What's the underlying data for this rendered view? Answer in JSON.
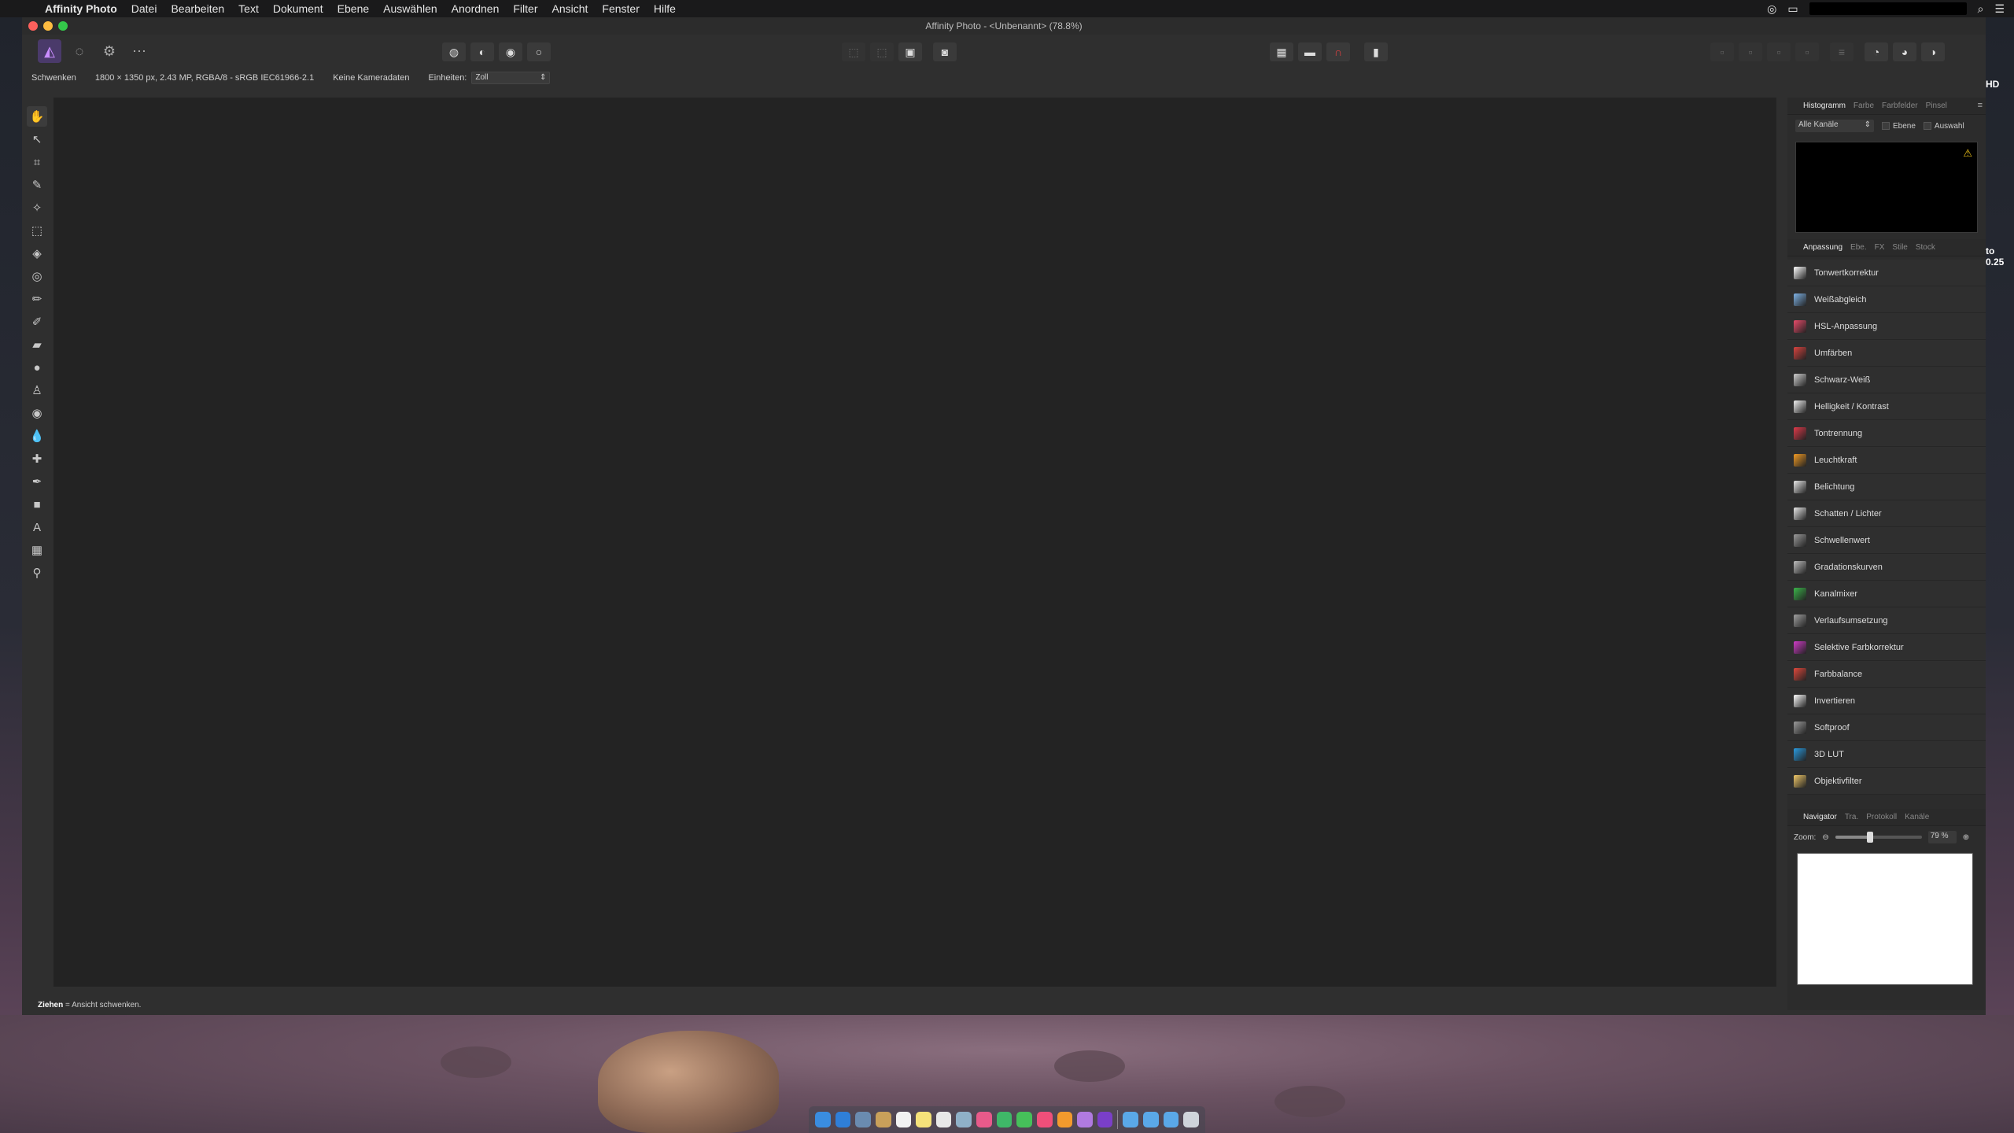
{
  "menubar": {
    "app_name": "Affinity Photo",
    "items": [
      "Datei",
      "Bearbeiten",
      "Text",
      "Dokument",
      "Ebene",
      "Auswählen",
      "Anordnen",
      "Filter",
      "Ansicht",
      "Fenster",
      "Hilfe"
    ]
  },
  "window": {
    "title": "Affinity Photo - <Unbenannt> (78.8%)"
  },
  "context_toolbar": {
    "tool_name": "Schwenken",
    "doc_info": "1800 × 1350 px, 2.43 MP, RGBA/8 - sRGB IEC61966-2.1",
    "camera": "Keine Kameradaten",
    "units_label": "Einheiten:",
    "units_value": "Zoll"
  },
  "status": {
    "key": "Ziehen",
    "text": " = Ansicht schwenken."
  },
  "histogram_panel": {
    "tabs": [
      "Histogramm",
      "Farbe",
      "Farbfelder",
      "Pinsel"
    ],
    "channel_select": "Alle Kanäle",
    "layer_label": "Ebene",
    "selection_label": "Auswahl"
  },
  "adjust_panel": {
    "tabs": [
      "Anpassung",
      "Ebe.",
      "FX",
      "Stile",
      "Stock"
    ],
    "items": [
      {
        "label": "Tonwertkorrektur",
        "color": "#ffffff"
      },
      {
        "label": "Weißabgleich",
        "color": "#7fb3e6"
      },
      {
        "label": "HSL-Anpassung",
        "color": "#e94b6a"
      },
      {
        "label": "Umfärben",
        "color": "#d9433f"
      },
      {
        "label": "Schwarz-Weiß",
        "color": "#cfcfcf"
      },
      {
        "label": "Helligkeit / Kontrast",
        "color": "#f0f0f0"
      },
      {
        "label": "Tontrennung",
        "color": "#e03a4a"
      },
      {
        "label": "Leuchtkraft",
        "color": "#f29b24"
      },
      {
        "label": "Belichtung",
        "color": "#e8e8e8"
      },
      {
        "label": "Schatten / Lichter",
        "color": "#e8e8e8"
      },
      {
        "label": "Schwellenwert",
        "color": "#9a9a9a"
      },
      {
        "label": "Gradationskurven",
        "color": "#bdbdbd"
      },
      {
        "label": "Kanalmixer",
        "color": "#3bb54a"
      },
      {
        "label": "Verlaufsumsetzung",
        "color": "#a0a0a0"
      },
      {
        "label": "Selektive Farbkorrektur",
        "color": "#cf3cc7"
      },
      {
        "label": "Farbbalance",
        "color": "#e0483c"
      },
      {
        "label": "Invertieren",
        "color": "#ffffff"
      },
      {
        "label": "Softproof",
        "color": "#9a9a9a"
      },
      {
        "label": "3D LUT",
        "color": "#2a9be0"
      },
      {
        "label": "Objektivfilter",
        "color": "#f1c96a"
      }
    ]
  },
  "navigator_panel": {
    "tabs": [
      "Navigator",
      "Tra.",
      "Protokoll",
      "Kanäle"
    ],
    "zoom_label": "Zoom:",
    "zoom_value": "79 %",
    "zoom_fraction": 0.4
  },
  "background_window": {
    "text_1": "HD",
    "text_2": "to",
    "text_3": "0.25"
  }
}
